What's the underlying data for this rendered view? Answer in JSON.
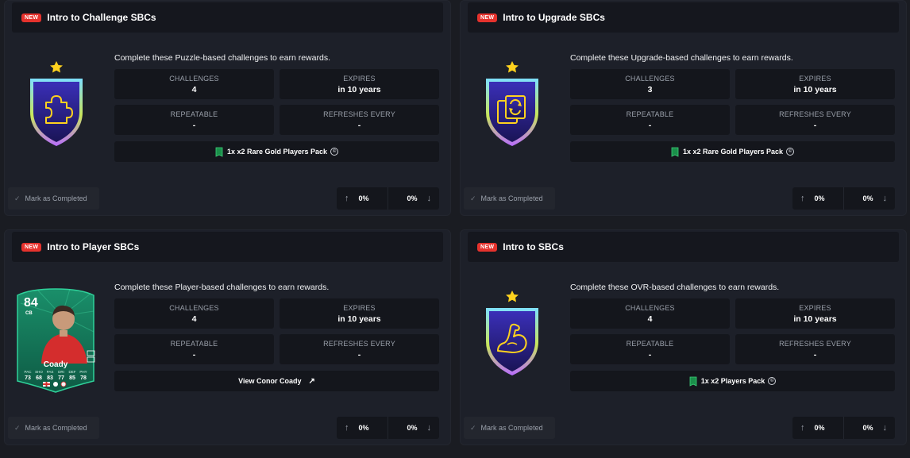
{
  "labels": {
    "new": "NEW",
    "challenges": "CHALLENGES",
    "expires": "EXPIRES",
    "repeatable": "REPEATABLE",
    "refreshes": "REFRESHES EVERY",
    "mark_completed": "Mark as Completed",
    "coin_symbol": "©"
  },
  "cards": [
    {
      "title": "Intro to Challenge SBCs",
      "description": "Complete these Puzzle-based challenges to earn rewards.",
      "challenges": "4",
      "expires": "in 10 years",
      "repeatable": "-",
      "refreshes": "-",
      "reward": "1x x2 Rare Gold Players Pack",
      "badge_icon": "puzzle-icon",
      "upvotes": "0%",
      "downvotes": "0%"
    },
    {
      "title": "Intro to Upgrade SBCs",
      "description": "Complete these Upgrade-based challenges to earn rewards.",
      "challenges": "3",
      "expires": "in 10 years",
      "repeatable": "-",
      "refreshes": "-",
      "reward": "1x x2 Rare Gold Players Pack",
      "badge_icon": "refresh-icon",
      "upvotes": "0%",
      "downvotes": "0%"
    },
    {
      "title": "Intro to Player SBCs",
      "description": "Complete these Player-based challenges to earn rewards.",
      "challenges": "4",
      "expires": "in 10 years",
      "repeatable": "-",
      "refreshes": "-",
      "reward": "View Conor Coady",
      "badge_icon": "player-card",
      "player": {
        "rating": "84",
        "position": "CB",
        "name": "Coady",
        "stat_labels": [
          "PAC",
          "SHO",
          "PAS",
          "DRI",
          "DEF",
          "PHY"
        ],
        "stat_values": [
          "73",
          "68",
          "83",
          "77",
          "85",
          "78"
        ]
      },
      "upvotes": "0%",
      "downvotes": "0%"
    },
    {
      "title": "Intro to SBCs",
      "description": "Complete these OVR-based challenges to earn rewards.",
      "challenges": "4",
      "expires": "in 10 years",
      "repeatable": "-",
      "refreshes": "-",
      "reward": "1x x2 Players Pack",
      "badge_icon": "flexed-arm-icon",
      "upvotes": "0%",
      "downvotes": "0%"
    }
  ],
  "colors": {
    "page_bg": "#1a1c22",
    "card_bg": "#1d2029",
    "panel_bg": "#14161c",
    "new_badge": "#e5322d",
    "badge_icon": "#ffd21e",
    "badge_border": "#6fd4ff",
    "badge_fill": "#2b1e8c",
    "player_card": "#1d9a6c"
  }
}
